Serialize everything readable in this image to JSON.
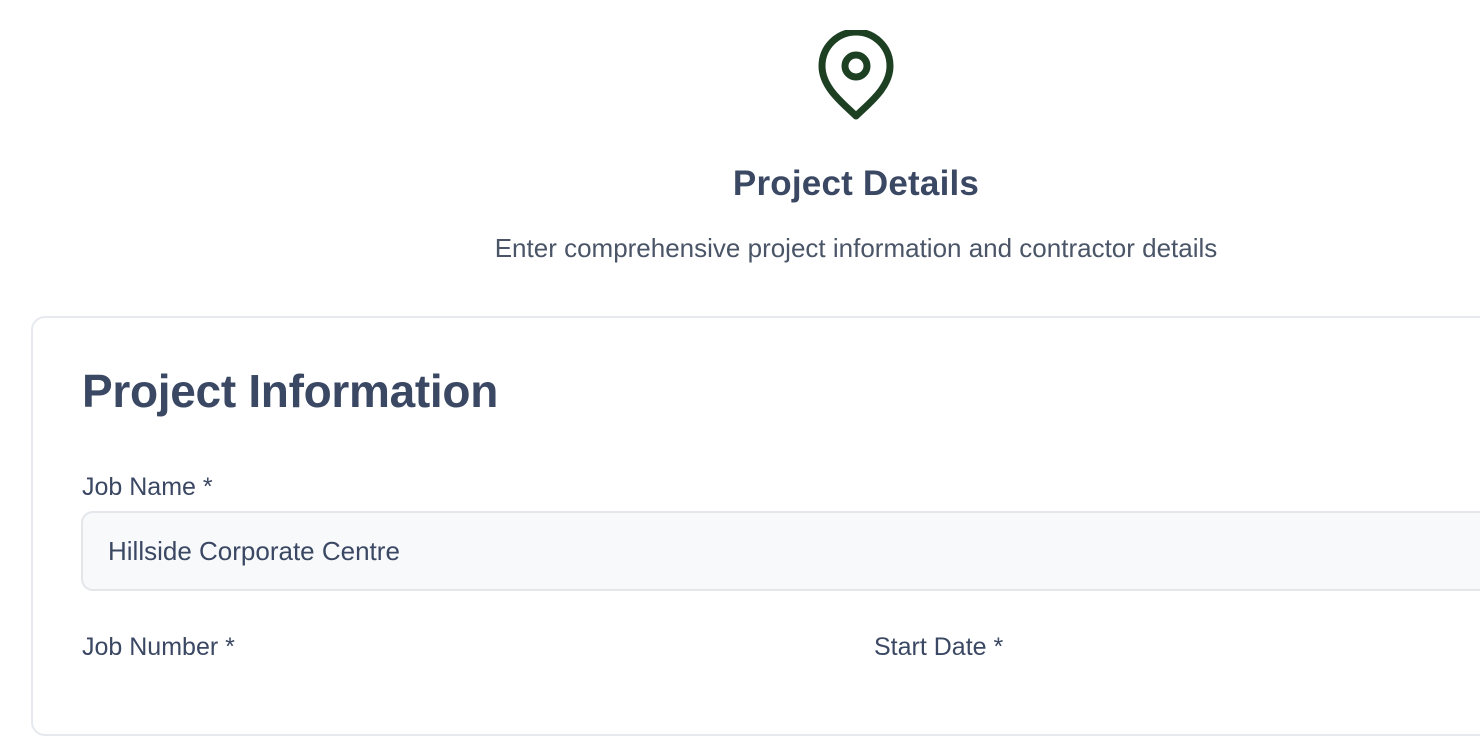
{
  "header": {
    "icon": "map-pin-icon",
    "title": "Project Details",
    "subtitle": "Enter comprehensive project information and contractor details",
    "accent_color": "#1d3f22"
  },
  "form": {
    "section_title": "Project Information",
    "fields": {
      "job_name": {
        "label": "Job Name *",
        "value": "Hillside Corporate Centre"
      },
      "job_number": {
        "label": "Job Number *"
      },
      "start_date": {
        "label": "Start Date *"
      }
    }
  }
}
